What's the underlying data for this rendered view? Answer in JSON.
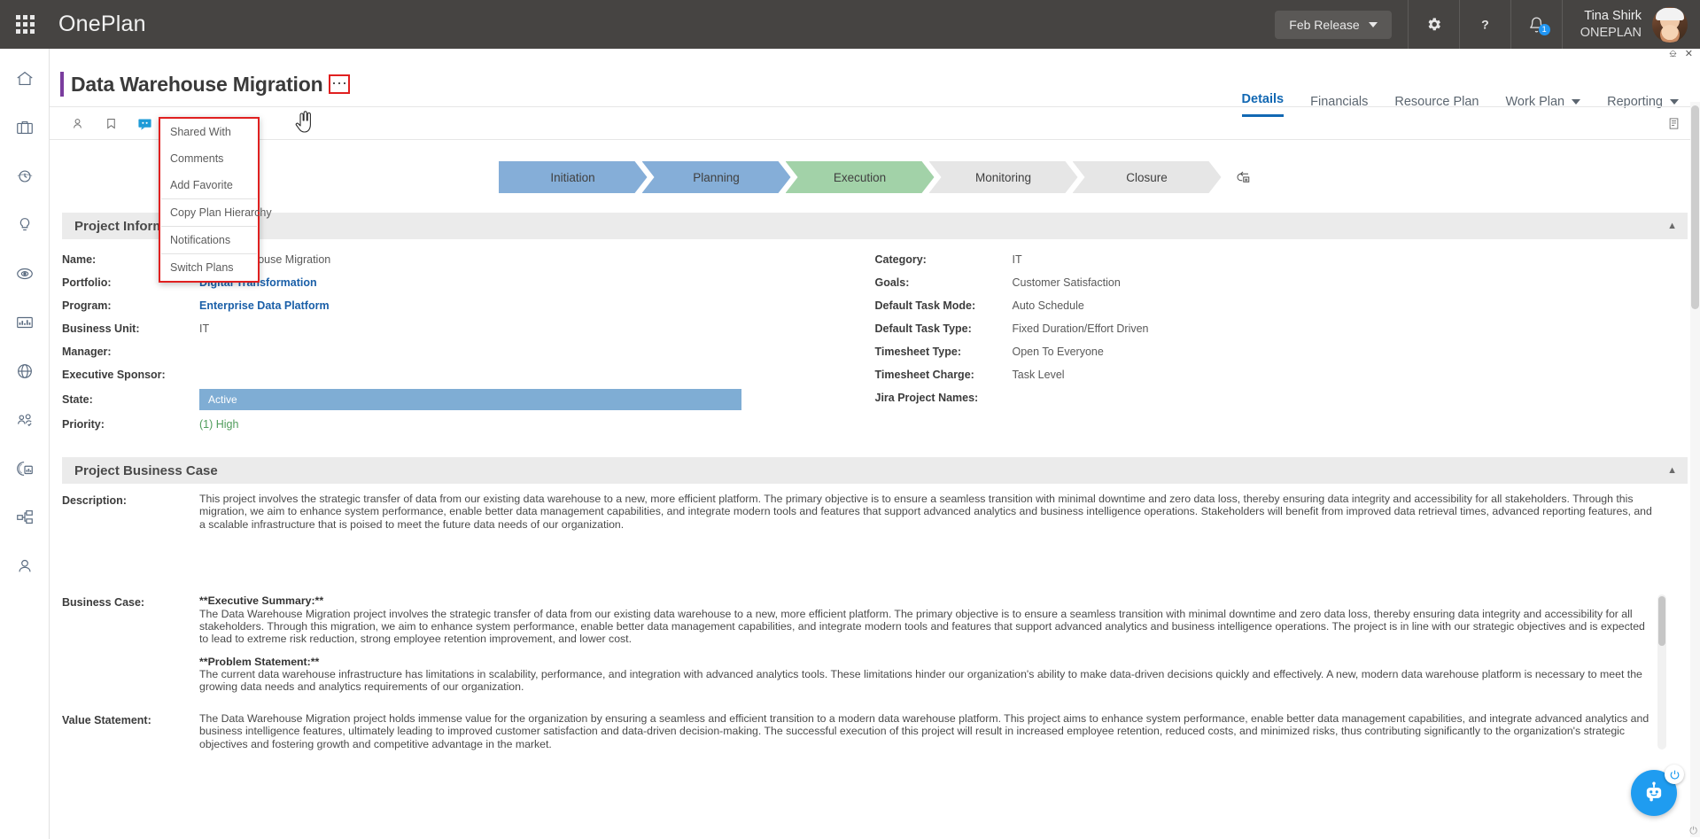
{
  "topbar": {
    "brand": "OnePlan",
    "release_label": "Feb Release",
    "notification_count": "1",
    "user_name": "Tina Shirk",
    "user_org": "ONEPLAN"
  },
  "rail": {
    "items": [
      {
        "icon": "home-icon",
        "name": "sidebar-item-home"
      },
      {
        "icon": "briefcase-icon",
        "name": "sidebar-item-portfolio"
      },
      {
        "icon": "clock-icon",
        "name": "sidebar-item-timesheet"
      },
      {
        "icon": "lightbulb-icon",
        "name": "sidebar-item-ideas"
      },
      {
        "icon": "target-icon",
        "name": "sidebar-item-goals"
      },
      {
        "icon": "chart-icon",
        "name": "sidebar-item-dashboards"
      },
      {
        "icon": "globe-icon",
        "name": "sidebar-item-global"
      },
      {
        "icon": "people-icon",
        "name": "sidebar-item-resources"
      },
      {
        "icon": "analytics-icon",
        "name": "sidebar-item-analytics"
      },
      {
        "icon": "hierarchy-icon",
        "name": "sidebar-item-hierarchy"
      },
      {
        "icon": "person-icon",
        "name": "sidebar-item-admin"
      }
    ]
  },
  "page": {
    "title": "Data Warehouse Migration",
    "tabs": [
      {
        "label": "Details",
        "active": true,
        "caret": false
      },
      {
        "label": "Financials",
        "active": false,
        "caret": false
      },
      {
        "label": "Resource Plan",
        "active": false,
        "caret": false
      },
      {
        "label": "Work Plan",
        "active": false,
        "caret": true
      },
      {
        "label": "Reporting",
        "active": false,
        "caret": true
      }
    ]
  },
  "context_menu": {
    "items": [
      {
        "label": "Shared With",
        "sep_after": false
      },
      {
        "label": "Comments",
        "sep_after": false
      },
      {
        "label": "Add Favorite",
        "sep_after": true
      },
      {
        "label": "Copy Plan Hierarchy",
        "sep_after": true
      },
      {
        "label": "Notifications",
        "sep_after": true
      },
      {
        "label": "Switch Plans",
        "sep_after": false
      }
    ]
  },
  "toolbar": {
    "icons": [
      {
        "name": "shared-with-icon",
        "active": false
      },
      {
        "name": "bookmark-icon",
        "active": false
      },
      {
        "name": "comments-icon",
        "active": true
      },
      {
        "name": "share-icon",
        "active": false
      }
    ],
    "notes_icon": "notes-icon"
  },
  "stages": [
    {
      "label": "Initiation",
      "state": "done"
    },
    {
      "label": "Planning",
      "state": "done"
    },
    {
      "label": "Execution",
      "state": "current"
    },
    {
      "label": "Monitoring",
      "state": "todo"
    },
    {
      "label": "Closure",
      "state": "todo"
    }
  ],
  "sections": {
    "project_information": {
      "title": "Project Information",
      "left_fields": [
        {
          "label": "Name:",
          "value": "Data Warehouse Migration",
          "style": "plain"
        },
        {
          "label": "Portfolio:",
          "value": "Digital Transformation",
          "style": "link"
        },
        {
          "label": "Program:",
          "value": "Enterprise Data Platform",
          "style": "link"
        },
        {
          "label": "Business Unit:",
          "value": "IT",
          "style": "plain"
        },
        {
          "label": "Manager:",
          "value": "",
          "style": "plain"
        },
        {
          "label": "Executive Sponsor:",
          "value": "",
          "style": "plain"
        },
        {
          "label": "State:",
          "value": "Active",
          "style": "statebar"
        },
        {
          "label": "Priority:",
          "value": "(1) High",
          "style": "green"
        }
      ],
      "right_fields": [
        {
          "label": "Category:",
          "value": "IT"
        },
        {
          "label": "Goals:",
          "value": "Customer Satisfaction"
        },
        {
          "label": "Default Task Mode:",
          "value": "Auto Schedule"
        },
        {
          "label": "Default Task Type:",
          "value": "Fixed Duration/Effort Driven"
        },
        {
          "label": "Timesheet Type:",
          "value": "Open To Everyone"
        },
        {
          "label": "Timesheet Charge:",
          "value": "Task Level"
        },
        {
          "label": "Jira Project Names:",
          "value": ""
        }
      ]
    },
    "project_business_case": {
      "title": "Project Business Case",
      "description_label": "Description:",
      "description_text": "This project involves the strategic transfer of data from our existing data warehouse to a new, more efficient platform. The primary objective is to ensure a seamless transition with minimal downtime and zero data loss, thereby ensuring data integrity and accessibility for all stakeholders. Through this migration, we aim to enhance system performance, enable better data management capabilities, and integrate modern tools and features that support advanced analytics and business intelligence operations. Stakeholders will benefit from improved data retrieval times, advanced reporting features, and a scalable infrastructure that is poised to meet the future data needs of our organization.",
      "business_case_label": "Business Case:",
      "business_case_heading_1": "**Executive Summary:**",
      "business_case_para_1": "The Data Warehouse Migration project involves the strategic transfer of data from our existing data warehouse to a new, more efficient platform. The primary objective is to ensure a seamless transition with minimal downtime and zero data loss, thereby ensuring data integrity and accessibility for all stakeholders. Through this migration, we aim to enhance system performance, enable better data management capabilities, and integrate modern tools and features that support advanced analytics and business intelligence operations. The project is in line with our strategic objectives and is expected to lead to extreme risk reduction, strong employee retention improvement, and lower cost.",
      "business_case_heading_2": "**Problem Statement:**",
      "business_case_para_2": "The current data warehouse infrastructure has limitations in scalability, performance, and integration with advanced analytics tools. These limitations hinder our organization's ability to make data-driven decisions quickly and effectively. A new, modern data warehouse platform is necessary to meet the growing data needs and analytics requirements of our organization.",
      "value_statement_label": "Value Statement:",
      "value_statement_text": "The Data Warehouse Migration project holds immense value for the organization by ensuring a seamless and efficient transition to a modern data warehouse platform. This project aims to enhance system performance, enable better data management capabilities, and integrate advanced analytics and business intelligence features, ultimately leading to improved customer satisfaction and data-driven decision-making. The successful execution of this project will result in increased employee retention, reduced costs, and minimized risks, thus contributing significantly to the organization's strategic objectives and fostering growth and competitive advantage in the market."
    }
  },
  "assistant": {
    "bot_icon": "robot-icon",
    "power_icon": "power-icon"
  },
  "colors": {
    "topbar_bg": "#464442",
    "accent_blue": "#1268b3",
    "stage_done": "#85aed8",
    "stage_current": "#a2d2a8",
    "stage_todo": "#e6e6e6",
    "highlight_red": "#e02020",
    "bot_blue": "#1f9cf0"
  }
}
